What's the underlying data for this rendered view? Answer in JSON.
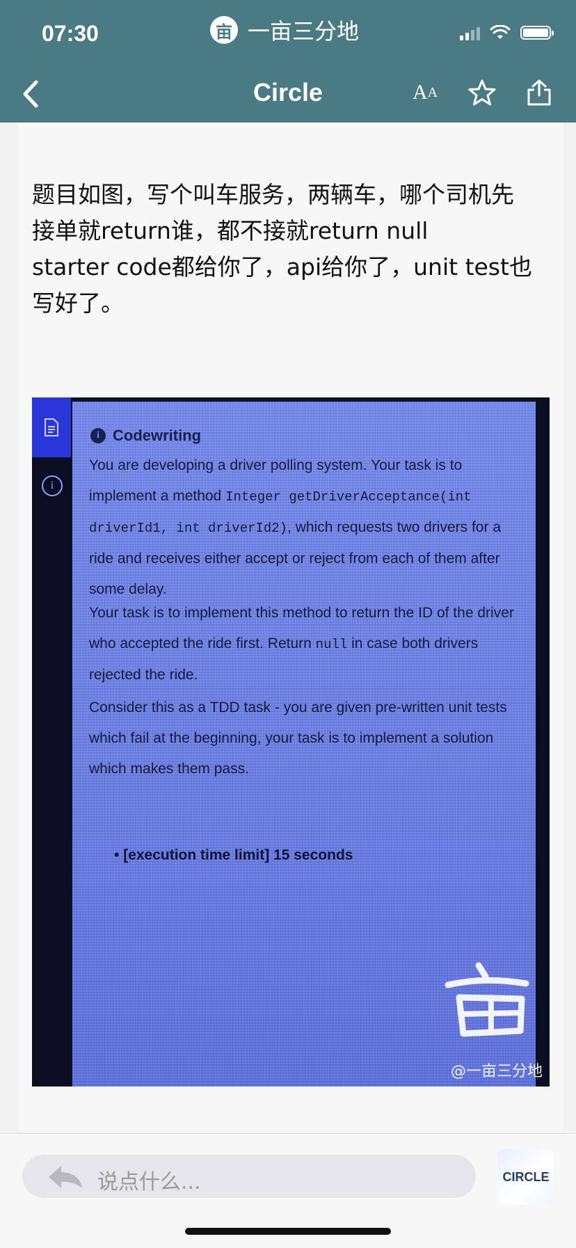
{
  "status_bar": {
    "time": "07:30",
    "app_name": "一亩三分地",
    "app_logo_glyph": "亩"
  },
  "nav": {
    "title": "Circle",
    "font_size_label": "A",
    "font_size_label_small": "A",
    "icons": [
      "back-chevron-icon",
      "font-size-icon",
      "star-icon",
      "share-icon"
    ]
  },
  "post": {
    "text": "题目如图，写个叫车服务，两辆车，哪个司机先\n接单就return谁，都不接就return null\nstarter code都给你了，api给你了，unit test也\n写好了。"
  },
  "photo": {
    "header": "Codewriting",
    "p1_a": "You are developing a driver polling system. Your task is to implement a method ",
    "p1_code": "Integer getDriverAcceptance(int driverId1, int driverId2)",
    "p1_b": ", which requests two drivers for a ride and receives either accept or reject from each of them after some delay.",
    "p2_a": "Your task is to implement this method to return the ID of the driver who accepted the ride first. Return ",
    "p2_code": "null",
    "p2_b": " in case both drivers rejected the ride.",
    "p3": "Consider this as a TDD task - you are given pre-written unit tests which fail at the beginning, your task is to implement a solution which makes them pass.",
    "bullet": "[execution time limit] 15 seconds",
    "watermark_glyph": "亩",
    "watermark_text": "@一亩三分地"
  },
  "comment": {
    "placeholder": "说点什么..."
  },
  "badge": {
    "label": "CIRCLE"
  },
  "colors": {
    "header_bg": "#4a7b84",
    "photo_screen": "#6a7fe8",
    "page_bg": "#f7f7f7"
  }
}
